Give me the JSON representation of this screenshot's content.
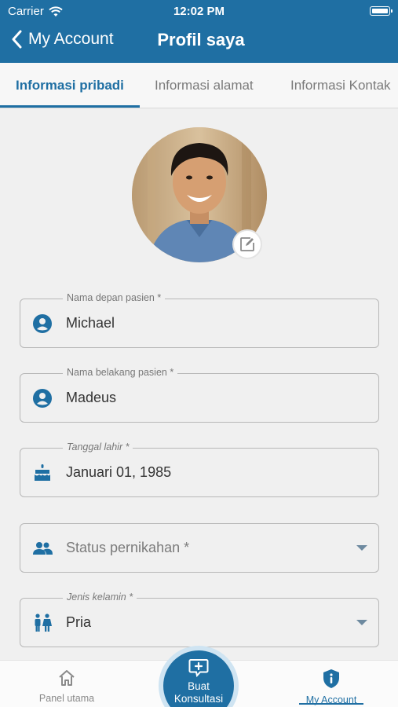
{
  "status_bar": {
    "carrier": "Carrier",
    "time": "12:02 PM"
  },
  "nav": {
    "back_label": "My Account",
    "title": "Profil saya"
  },
  "tabs": [
    {
      "label": "Informasi pribadi",
      "active": true
    },
    {
      "label": "Informasi alamat",
      "active": false
    },
    {
      "label": "Informasi Kontak",
      "active": false
    }
  ],
  "form": {
    "first_name": {
      "label": "Nama depan pasien *",
      "value": "Michael"
    },
    "last_name": {
      "label": "Nama belakang pasien *",
      "value": "Madeus"
    },
    "birth_date": {
      "label": "Tanggal lahir *",
      "value": "Januari 01, 1985"
    },
    "marital_status": {
      "placeholder": "Status pernikahan *"
    },
    "gender": {
      "label": "Jenis kelamin *",
      "value": "Pria"
    }
  },
  "bottom_nav": {
    "home_label": "Panel utama",
    "fab_label_line1": "Buat",
    "fab_label_line2": "Konsultasi",
    "account_label": "My Account"
  },
  "colors": {
    "primary": "#1f6fa3",
    "background": "#f0f0f0",
    "tab_bar": "#f7f7f7"
  },
  "icons": [
    "wifi-icon",
    "battery-icon",
    "back-chevron-icon",
    "edit-icon",
    "person-circle-icon",
    "cake-icon",
    "people-icon",
    "gender-icon",
    "dropdown-caret-icon",
    "home-icon",
    "chat-plus-icon",
    "shield-info-icon"
  ]
}
